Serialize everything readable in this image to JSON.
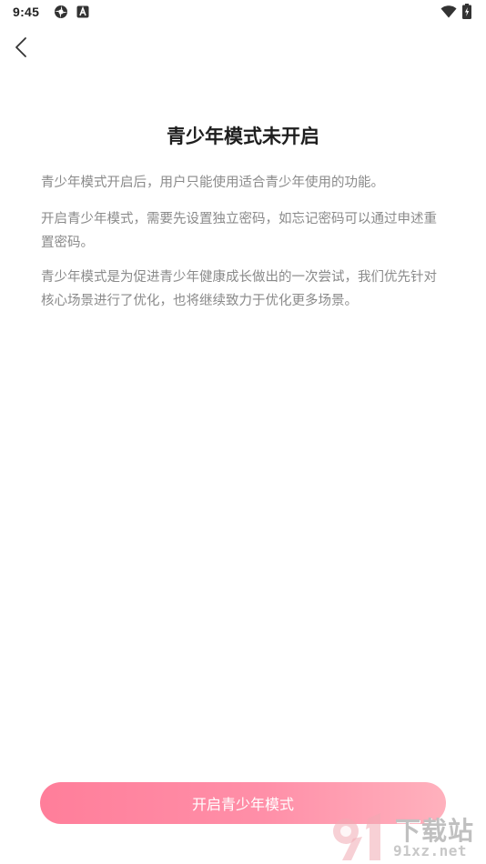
{
  "status_bar": {
    "time": "9:45",
    "icons": [
      "settings-app-icon",
      "a-badge-icon",
      "wifi-icon",
      "battery-charging-icon"
    ]
  },
  "header": {
    "back_icon": "chevron-left-icon"
  },
  "main": {
    "title": "青少年模式未开启",
    "paragraphs": [
      "青少年模式开启后，用户只能使用适合青少年使用的功能。",
      "开启青少年模式，需要先设置独立密码，如忘记密码可以通过申述重置密码。",
      "青少年模式是为促进青少年健康成长做出的一次尝试，我们优先针对核心场景进行了优化，也将继续致力于优化更多场景。"
    ]
  },
  "footer": {
    "enable_button_label": "开启青少年模式"
  },
  "watermark": {
    "title": "下载站",
    "domain": "91xz.net"
  },
  "colors": {
    "accent_gradient_start": "#ff7e9a",
    "accent_gradient_end": "#ffb1bd",
    "title_text": "#1e1e1e",
    "body_text": "#8a8a8a"
  }
}
